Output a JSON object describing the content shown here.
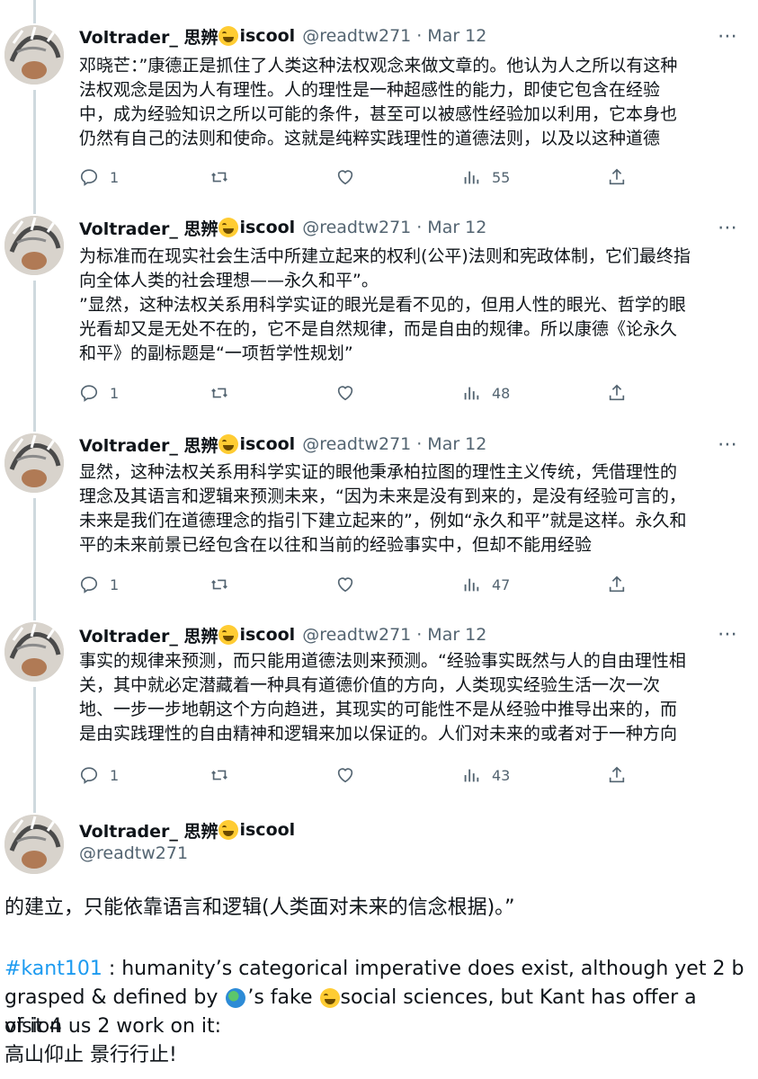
{
  "author": {
    "display_name_prefix": "Voltrader_ 思辨",
    "display_name_suffix": "iscool",
    "handle": "@readtw271",
    "date": "Mar 12",
    "separator": "·"
  },
  "tweets": [
    {
      "text": "邓晓芒：”康德正是抓住了人类这种法权观念来做文章的。他认为人之所以有这种\n法权观念是因为人有理性。人的理性是一种超感性的能力，即使它包含在经验\n中，成为经验知识之所以可能的条件，甚至可以被感性经验加以利用，它本身也\n仍然有自己的法则和使命。这就是纯粹实践理性的道德法则，以及以这种道德",
      "replies": "1",
      "views": "55"
    },
    {
      "text": "为标准而在现实社会生活中所建立起来的权利(公平)法则和宪政体制，它们最终指\n向全体人类的社会理想——永久和平”。\n”显然，这种法权关系用科学实证的眼光是看不见的，但用人性的眼光、哲学的眼\n光看却又是无处不在的，它不是自然规律，而是自由的规律。所以康德《论永久\n和平》的副标题是“一项哲学性规划”",
      "replies": "1",
      "views": "48"
    },
    {
      "text": "显然，这种法权关系用科学实证的眼他秉承柏拉图的理性主义传统，凭借理性的\n理念及其语言和逻辑来预测未来，“因为未来是没有到来的，是没有经验可言的，\n未来是我们在道德理念的指引下建立起来的”，例如“永久和平”就是这样。永久和\n平的未来前景已经包含在以往和当前的经验事实中，但却不能用经验",
      "replies": "1",
      "views": "47"
    },
    {
      "text": "事实的规律来预测，而只能用道德法则来预测。“经验事实既然与人的自由理性相\n关，其中就必定潜藏着一种具有道德价值的方向，人类现实经验生活一次一次\n地、一步一步地朝这个方向趋进，其现实的可能性不是从经验中推导出来的，而\n是由实践理性的自由精神和逻辑来加以保证的。人们对未来的或者对于一种方向",
      "replies": "1",
      "views": "43"
    }
  ],
  "final_tweet": {
    "line1": "的建立，只能依靠语言和逻辑(人类面对未来的信念根据)。”",
    "hashtag": "#kant101",
    "line2_rest": " : humanity’s categorical imperative does exist, although yet 2 b",
    "line3_pre": "grasped & defined by ",
    "line3_mid": "’s fake ",
    "line3_post": "social sciences,  but Kant has offer a vision",
    "line4": "of it 4 us 2 work on it:",
    "line5": "高山仰止 景行行止!"
  },
  "icons": {
    "reply": "reply-icon",
    "retweet": "retweet-icon",
    "like": "heart-icon",
    "views": "views-icon",
    "share": "share-icon",
    "more": "more-icon",
    "emoji": "laughing-crying-emoji",
    "globe": "globe-emoji"
  },
  "colors": {
    "text": "#0f1419",
    "secondary": "#536471",
    "link": "#1d9bf0",
    "thread_line": "#cfd9de"
  }
}
